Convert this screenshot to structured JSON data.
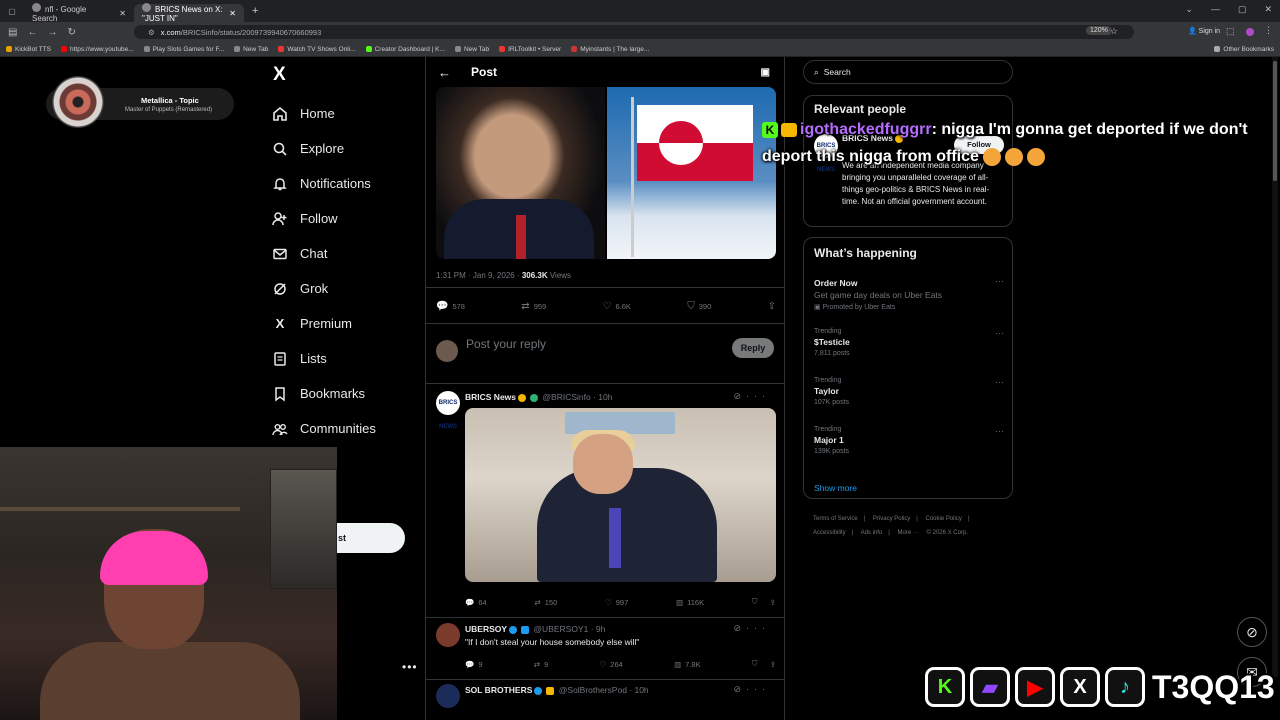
{
  "browser": {
    "tabs": [
      {
        "title": "nfl - Google Search"
      },
      {
        "title": "BRICS News on X: \"JUST IN\""
      }
    ],
    "new_tab": "+",
    "url_host": "x.com",
    "url_path": "/BRICSinfo/status/2009739940670660993",
    "zoom": "120%",
    "signin": "Sign in",
    "bookmarks": [
      "KickBot TTS",
      "https://www.youtube...",
      "Play Slots Games for F...",
      "New Tab",
      "Watch TV Shows Onli...",
      "Creator Dashboard | K...",
      "New Tab",
      "IRLToolkit • Server",
      "Myinstants | The large..."
    ],
    "other_bookmarks": "Other Bookmarks"
  },
  "music": {
    "artist": "Metallica - Topic",
    "track": "Master of Puppets (Remastered)"
  },
  "sidebar": {
    "logo": "X",
    "items": [
      {
        "label": "Home",
        "icon": "home-icon"
      },
      {
        "label": "Explore",
        "icon": "search-icon"
      },
      {
        "label": "Notifications",
        "icon": "bell-icon"
      },
      {
        "label": "Follow",
        "icon": "person-plus-icon"
      },
      {
        "label": "Chat",
        "icon": "mail-icon"
      },
      {
        "label": "Grok",
        "icon": "grok-icon"
      },
      {
        "label": "Premium",
        "icon": "x-icon"
      },
      {
        "label": "Lists",
        "icon": "list-icon"
      },
      {
        "label": "Bookmarks",
        "icon": "bookmark-icon"
      },
      {
        "label": "Communities",
        "icon": "people-icon"
      }
    ],
    "post_button": "st",
    "more": "•••"
  },
  "post": {
    "header": "Post",
    "timestamp": "1:31 PM · Jan 9, 2026 · ",
    "views_count": "306.3K",
    "views_label": " Views",
    "replies": "578",
    "reposts": "959",
    "likes": "6.6K",
    "bookmarks": "390",
    "reply_placeholder": "Post your reply",
    "reply_button": "Reply"
  },
  "replies": [
    {
      "avatar": "BRICS NEWS",
      "name": "BRICS News",
      "handle": "@BRICSinfo · 10h",
      "text": "",
      "replies": "64",
      "reposts": "150",
      "likes": "997",
      "views": "116K"
    },
    {
      "avatar": "",
      "name": "UBERSOY",
      "handle": "@UBERSOY1 · 9h",
      "text": "\"If I don't steal your house somebody else will\"",
      "replies": "9",
      "reposts": "9",
      "likes": "264",
      "views": "7.8K"
    },
    {
      "avatar": "",
      "name": "SOL BROTHERS",
      "handle": "@SolBrothersPod · 10h",
      "text": ""
    }
  ],
  "right": {
    "search_placeholder": "Search",
    "relevant_title": "Relevant people",
    "person_avatar": "BRICS NEWS",
    "person_name": "BRICS News",
    "follow": "Follow",
    "person_bio": "We are an independent media company bringing you unparalleled coverage of all-things geo-politics & BRICS News in real-time. Not an official government account.",
    "happening_title": "What’s happening",
    "promo": {
      "title": "Order Now",
      "sub": "Get game day deals on Uber Eats",
      "promoted": "Promoted by Uber Eats"
    },
    "trends": [
      {
        "label": "Trending",
        "title": "$Testicle",
        "count": "7,811 posts"
      },
      {
        "label": "Trending",
        "title": "Taylor",
        "count": "107K posts"
      },
      {
        "label": "Trending",
        "title": "Major 1",
        "count": "139K posts"
      }
    ],
    "show_more": "Show more",
    "footer": [
      "Terms of Service",
      "|",
      "Privacy Policy",
      "|",
      "Cookie Policy",
      "|",
      "Accessibility",
      "|",
      "Ads info",
      "|",
      "More ···",
      "© 2026 X Corp."
    ]
  },
  "overlay": {
    "chat_user": "igothackedfuggrr",
    "chat_text": ": nigga I'm gonna get deported if we don't deport this nigga from office",
    "handle": "T3QQ13"
  },
  "colors": {
    "accent": "#1d9bf0",
    "kick": "#53fc18",
    "overlay_user": "#b56cff"
  }
}
